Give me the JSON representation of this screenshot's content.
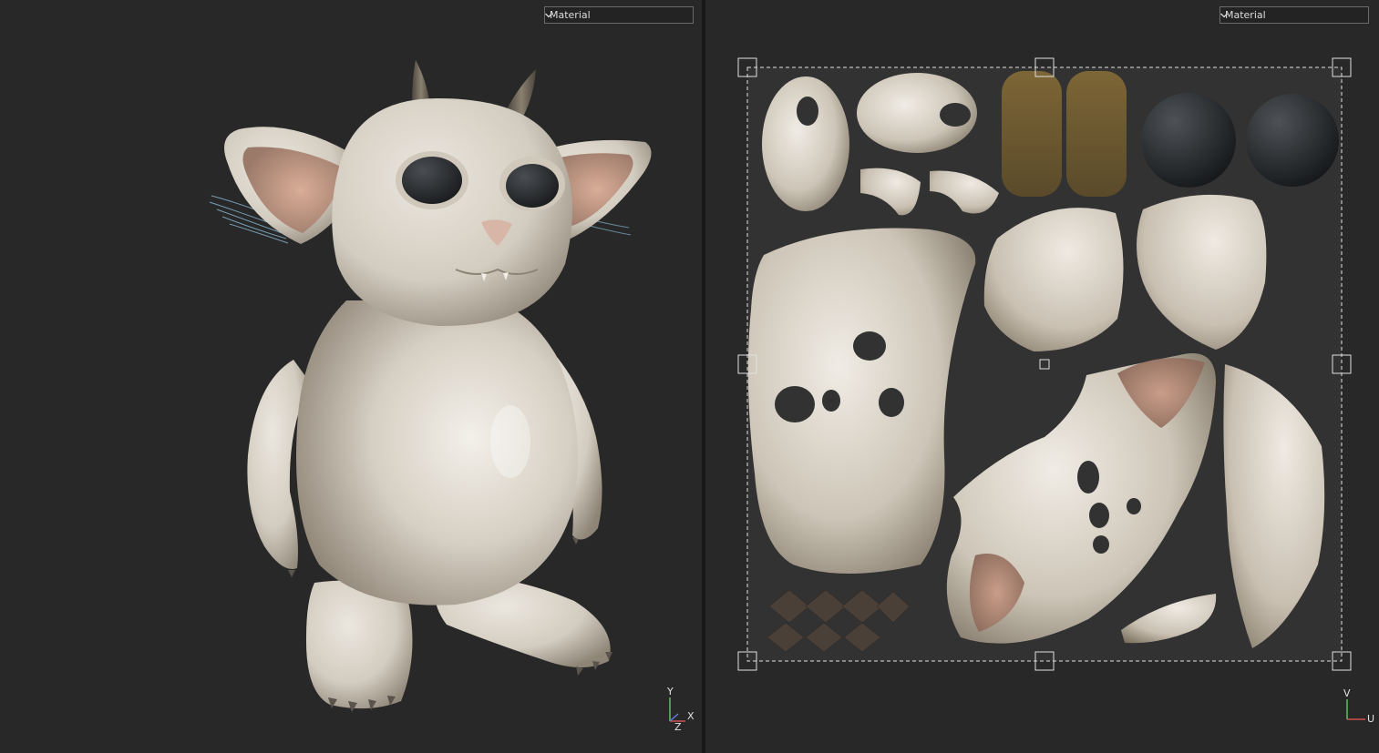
{
  "viewport_3d": {
    "shading_dropdown": {
      "value": "Material"
    },
    "axis_gizmo": {
      "y": "Y",
      "x": "X",
      "z": "Z"
    }
  },
  "viewport_uv": {
    "shading_dropdown": {
      "value": "Material"
    },
    "axis_gizmo": {
      "v": "V",
      "u": "U"
    }
  },
  "colors": {
    "viewport_bg": "#282828",
    "uv_bg": "#323232",
    "skin": "#d8d2c8",
    "ear_inner": "#c89a86",
    "eye": "#1e2022",
    "horn": "#6e665a",
    "sole": "#7a6232",
    "whiskers": "#8fc3e0"
  }
}
